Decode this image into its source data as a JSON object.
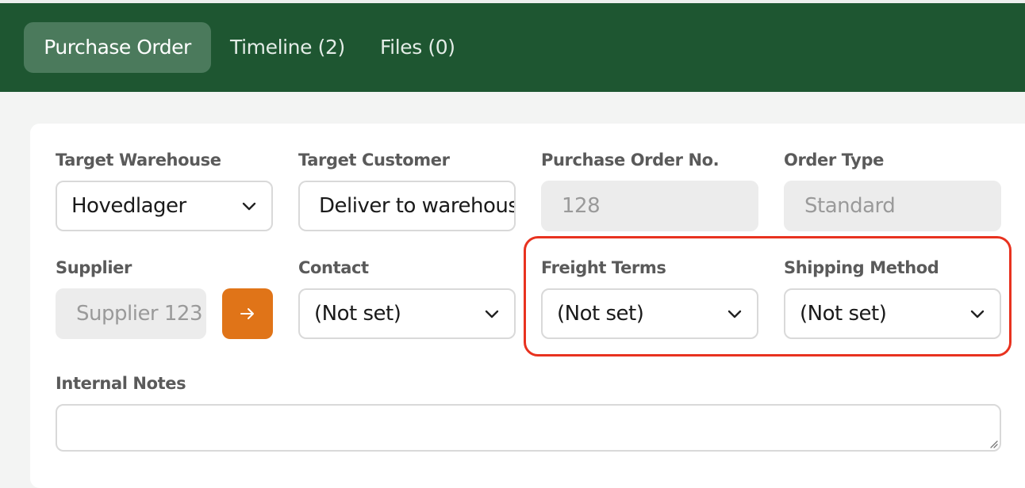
{
  "tabs": [
    {
      "label": "Purchase Order",
      "active": true
    },
    {
      "label": "Timeline (2)",
      "active": false
    },
    {
      "label": "Files (0)",
      "active": false
    }
  ],
  "form": {
    "target_warehouse": {
      "label": "Target Warehouse",
      "value": "Hovedlager"
    },
    "target_customer": {
      "label": "Target Customer",
      "value": "Deliver to warehouse"
    },
    "purchase_order_no": {
      "label": "Purchase Order No.",
      "value": "128"
    },
    "order_type": {
      "label": "Order Type",
      "value": "Standard"
    },
    "supplier": {
      "label": "Supplier",
      "value": "Supplier 123"
    },
    "contact": {
      "label": "Contact",
      "value": "(Not set)"
    },
    "freight_terms": {
      "label": "Freight Terms",
      "value": "(Not set)"
    },
    "shipping_method": {
      "label": "Shipping Method",
      "value": "(Not set)"
    },
    "internal_notes": {
      "label": "Internal Notes",
      "value": ""
    }
  },
  "icons": {
    "chevron": "chevron-down-icon",
    "supplier_button": "arrow-right-icon",
    "resize": "resize-handle-icon"
  },
  "colors": {
    "header_bg": "#1e5631",
    "active_tab_bg": "#4b7a5c",
    "accent_orange": "#e07418",
    "highlight_red": "#e8321f"
  }
}
